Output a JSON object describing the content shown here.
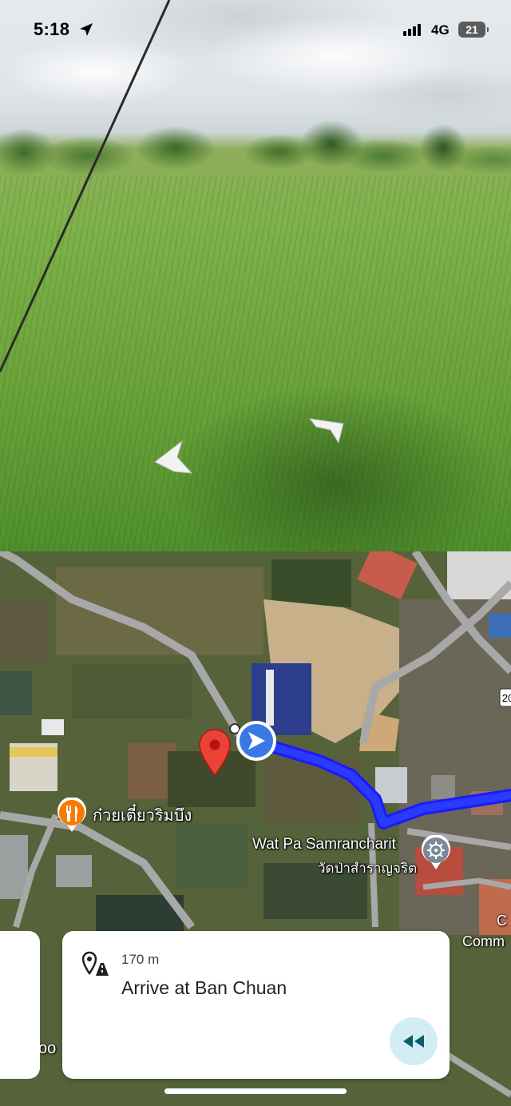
{
  "status_bar": {
    "time": "5:18",
    "network": "4G",
    "battery": "21"
  },
  "map": {
    "poi_restaurant": "ก๋วยเตี๋ยวริมบึง",
    "temple_name_en": "Wat Pa Samrancharit",
    "temple_name_th": "วัดป่าสำราญจริต",
    "edge_label_c": "C",
    "edge_label_comm": "Comm",
    "road_shield": "20",
    "left_card_fragment": "oo",
    "route_color": "#1a1aff",
    "marker_color": "#ea4335"
  },
  "navigation": {
    "distance": "170 m",
    "instruction": "Arrive at Ban Chuan"
  },
  "icons": {
    "location": "location-arrow-icon",
    "route": "route-pin-icon",
    "rewind": "rewind-icon",
    "restaurant": "restaurant-icon",
    "temple": "temple-icon"
  }
}
